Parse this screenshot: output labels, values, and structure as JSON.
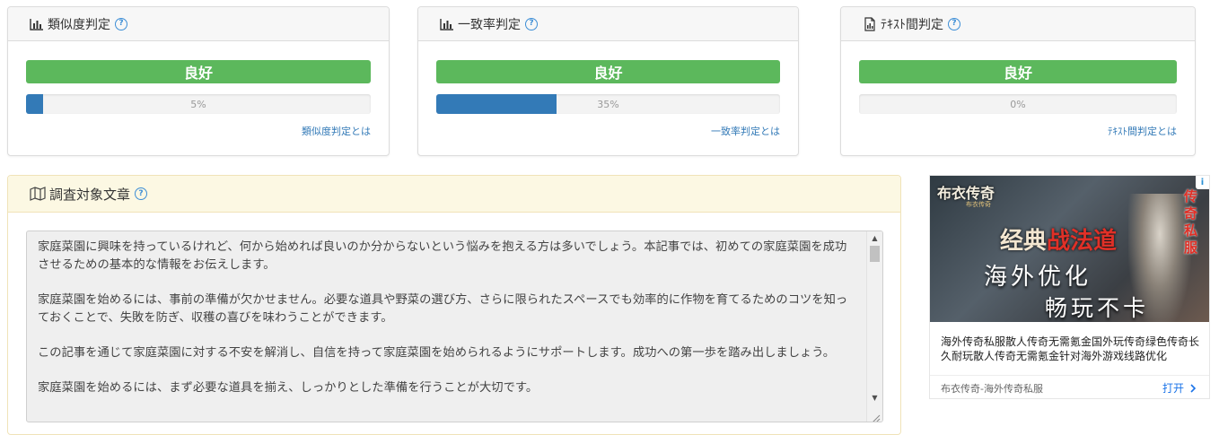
{
  "cards": [
    {
      "title": "類似度判定",
      "icon": "bar-chart-icon",
      "verdict": "良好",
      "percent": 5,
      "percent_label": "5%",
      "link": "類似度判定とは"
    },
    {
      "title": "一致率判定",
      "icon": "bar-chart-icon",
      "verdict": "良好",
      "percent": 35,
      "percent_label": "35%",
      "link": "一致率判定とは"
    },
    {
      "title": "ﾃｷｽﾄ間判定",
      "icon": "document-chart-icon",
      "verdict": "良好",
      "percent": 0,
      "percent_label": "0%",
      "link": "ﾃｷｽﾄ間判定とは"
    }
  ],
  "help_glyph": "?",
  "panel": {
    "title": "調査対象文章",
    "icon": "map-icon",
    "paragraphs": [
      "家庭菜園に興味を持っているけれど、何から始めれば良いのか分からないという悩みを抱える方は多いでしょう。本記事では、初めての家庭菜園を成功させるための基本的な情報をお伝えします。",
      "家庭菜園を始めるには、事前の準備が欠かせません。必要な道具や野菜の選び方、さらに限られたスペースでも効率的に作物を育てるためのコツを知っておくことで、失敗を防ぎ、収穫の喜びを味わうことができます。",
      "この記事を通じて家庭菜園に対する不安を解消し、自信を持って家庭菜園を始められるようにサポートします。成功への第一歩を踏み出しましょう。",
      "家庭菜園を始めるには、まず必要な道具を揃え、しっかりとした準備を行うことが大切です。"
    ]
  },
  "ad": {
    "logo": "布衣传奇",
    "logo_sub": "布衣传奇",
    "headline_a": "经典",
    "headline_b": "战法道",
    "line1": "海外优化",
    "line2": "畅玩不卡",
    "vertical": "传奇私服",
    "badge": "i",
    "title": "海外传奇私服散人传奇无需氪金国外玩传奇绿色传奇长久耐玩散人传奇无需氪金针对海外游戏线路优化",
    "source": "布衣传奇-海外传奇私服",
    "open_label": "打开",
    "accent": "#e03027"
  }
}
